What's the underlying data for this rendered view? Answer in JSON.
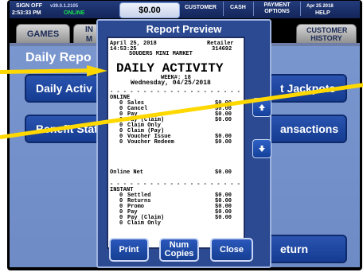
{
  "topbar": {
    "sign_off": "SIGN OFF",
    "time": "2:53:33 PM",
    "version": "v39.0.1.2105",
    "status": "ONLINE",
    "balance": "$0.00",
    "customer": "CUSTOMER",
    "cash": "CASH",
    "payment_options": "PAYMENT OPTIONS",
    "date": "Apr 25 2018",
    "help": "HELP"
  },
  "tabs": {
    "games": "GAMES",
    "in_partial": "IN",
    "m_partial": "M",
    "customer_history": "CUSTOMER HISTORY"
  },
  "main": {
    "title_partial": "Daily Repo",
    "daily_activity_partial": "Daily Activ",
    "benefit_partial": "Benefit Stat",
    "jackpots_partial": "t Jackpots",
    "transactions_partial": "ansactions",
    "return_partial": "eturn"
  },
  "modal": {
    "title": "Report Preview",
    "print": "Print",
    "num_copies": "Num Copies",
    "close": "Close"
  },
  "receipt": {
    "date": "April 25, 2018",
    "retailer_label": "Retailer",
    "time": "14:53:25",
    "retailer_id": "314692",
    "store": "SOUDERS MINI MARKET",
    "heading": "DAILY ACTIVITY",
    "week": "WEEK#: 18",
    "day": "Wednesday, 04/25/2018",
    "online_label": "ONLINE",
    "online_rows": [
      {
        "count": "0",
        "label": "Sales",
        "amount": "$0.00"
      },
      {
        "count": "0",
        "label": "Cancel",
        "amount": "$0.00"
      },
      {
        "count": "0",
        "label": "Pay",
        "amount": "$0.00"
      },
      {
        "count": "0",
        "label": "Pay (Claim)",
        "amount": "$0.00"
      },
      {
        "count": "0",
        "label": "Claim Only",
        "amount": ""
      },
      {
        "count": "0",
        "label": "Claim (Pay)",
        "amount": ""
      },
      {
        "count": "0",
        "label": "Voucher Issue",
        "amount": "$0.00"
      },
      {
        "count": "0",
        "label": "Voucher Redeem",
        "amount": "$0.00"
      }
    ],
    "online_net_label": "Online Net",
    "online_net_amount": "$0.00",
    "instant_label": "INSTANT",
    "instant_rows": [
      {
        "count": "0",
        "label": "Settled",
        "amount": "$0.00"
      },
      {
        "count": "0",
        "label": "Returns",
        "amount": "$0.00"
      },
      {
        "count": "0",
        "label": "Promo",
        "amount": "$0.00"
      },
      {
        "count": "0",
        "label": "Pay",
        "amount": "$0.00"
      },
      {
        "count": "0",
        "label": "Pay (Claim)",
        "amount": "$0.00"
      },
      {
        "count": "0",
        "label": "Claim Only",
        "amount": ""
      }
    ]
  },
  "icons": {
    "up": "arrow-up-icon",
    "down": "arrow-down-icon"
  },
  "colors": {
    "annotation_stripe": "#ffd800",
    "panel_blue": "#7a96cf",
    "button_blue": "#1e4aa8"
  }
}
